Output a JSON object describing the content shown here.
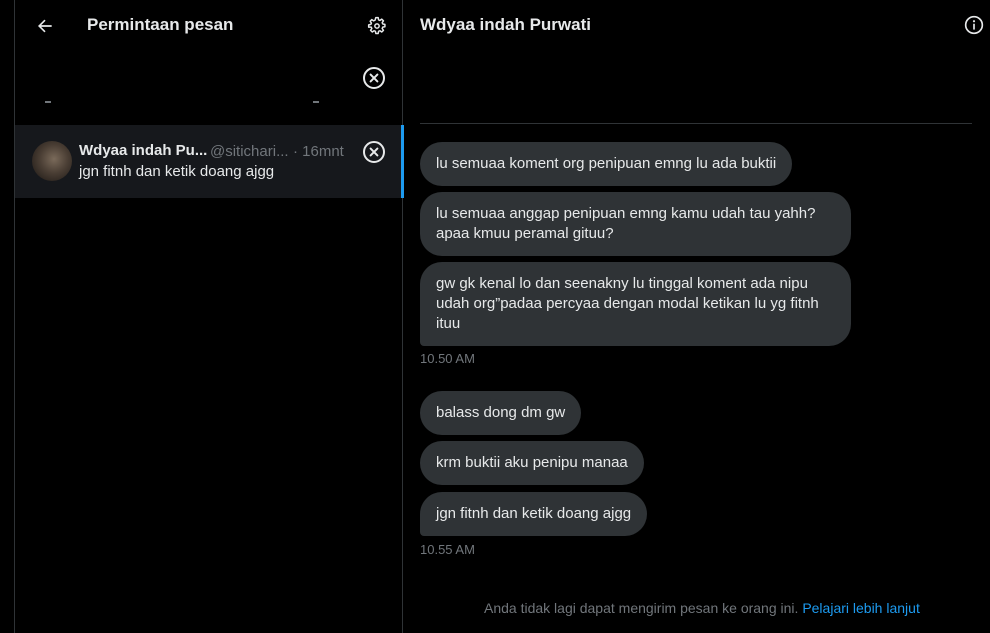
{
  "left": {
    "title": "Permintaan pesan",
    "icons": {
      "back": "arrow-left-icon",
      "settings": "gear-icon",
      "dismiss": "close-circle-icon"
    },
    "conversation": {
      "name": "Wdyaa indah Pu...",
      "handle": "@sitichari...",
      "time": "· 16mnt",
      "preview": "jgn fitnh dan ketik doang ajgg"
    }
  },
  "right": {
    "title": "Wdyaa indah Purwati",
    "icons": {
      "info": "info-icon"
    },
    "messages": [
      "lu semuaa koment org penipuan emng lu ada buktii",
      "lu semuaa anggap penipuan emng kamu udah tau yahh? apaa kmuu peramal gituu?",
      "gw gk kenal lo dan seenakny lu tinggal koment ada nipu udah org”padaa percyaa dengan modal ketikan lu yg fitnh ituu",
      "balass dong dm gw",
      "krm buktii aku penipu manaa",
      "jgn fitnh dan ketik doang ajgg"
    ],
    "timestamps": [
      "10.50 AM",
      "10.55 AM"
    ],
    "footer": {
      "text": "Anda tidak lagi dapat mengirim pesan ke orang ini.",
      "link": "Pelajari lebih lanjut"
    }
  },
  "colors": {
    "background": "#000000",
    "bubble": "#2f3336",
    "text": "#e7e9ea",
    "muted": "#71767b",
    "accent": "#1d9bf0",
    "selected": "#16181c"
  }
}
